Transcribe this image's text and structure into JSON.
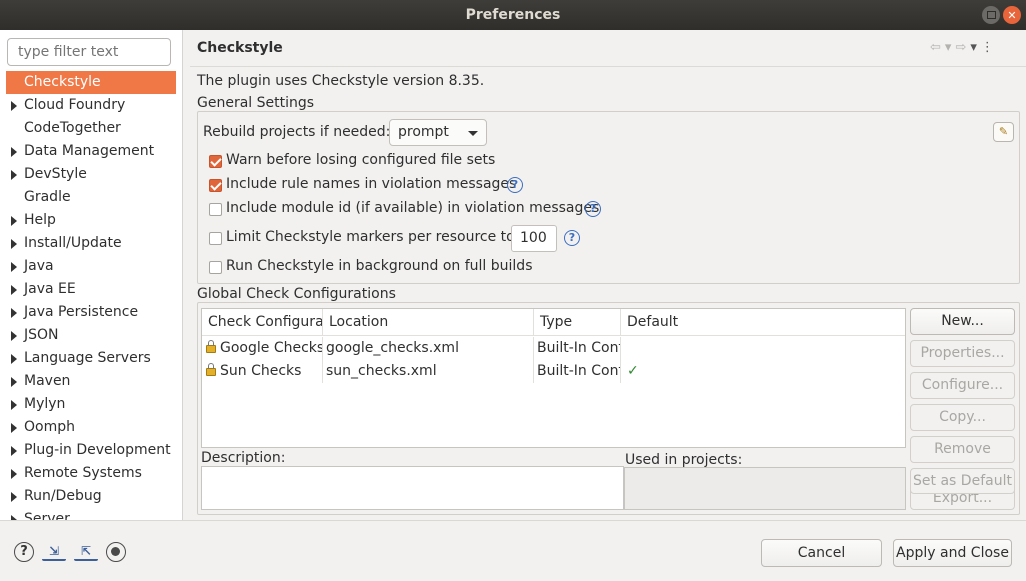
{
  "window": {
    "title": "Preferences"
  },
  "sidebar": {
    "filter_placeholder": "type filter text",
    "items": [
      {
        "label": "Checkstyle",
        "expandable": false,
        "selected": true
      },
      {
        "label": "Cloud Foundry",
        "expandable": true
      },
      {
        "label": "CodeTogether",
        "expandable": false
      },
      {
        "label": "Data Management",
        "expandable": true
      },
      {
        "label": "DevStyle",
        "expandable": true
      },
      {
        "label": "Gradle",
        "expandable": false
      },
      {
        "label": "Help",
        "expandable": true
      },
      {
        "label": "Install/Update",
        "expandable": true
      },
      {
        "label": "Java",
        "expandable": true
      },
      {
        "label": "Java EE",
        "expandable": true
      },
      {
        "label": "Java Persistence",
        "expandable": true
      },
      {
        "label": "JSON",
        "expandable": true
      },
      {
        "label": "Language Servers",
        "expandable": true
      },
      {
        "label": "Maven",
        "expandable": true
      },
      {
        "label": "Mylyn",
        "expandable": true
      },
      {
        "label": "Oomph",
        "expandable": true
      },
      {
        "label": "Plug-in Development",
        "expandable": true
      },
      {
        "label": "Remote Systems",
        "expandable": true
      },
      {
        "label": "Run/Debug",
        "expandable": true
      },
      {
        "label": "Server",
        "expandable": true
      }
    ]
  },
  "page": {
    "title": "Checkstyle",
    "version_text": "The plugin uses Checkstyle version 8.35.",
    "general": {
      "label": "General Settings",
      "rebuild_label": "Rebuild projects if needed:",
      "rebuild_value": "prompt",
      "options": [
        {
          "label": "Warn before losing configured file sets",
          "checked": true,
          "help": false
        },
        {
          "label": "Include rule names in violation messages",
          "checked": true,
          "help": true
        },
        {
          "label": "Include module id (if available) in violation messages",
          "checked": false,
          "help": true
        },
        {
          "label": "Limit Checkstyle markers per resource to",
          "checked": false,
          "help": true
        },
        {
          "label": "Run Checkstyle in background on full builds",
          "checked": false,
          "help": false
        }
      ],
      "marker_limit": "100"
    },
    "global": {
      "label": "Global Check Configurations",
      "columns": [
        "Check Configuration",
        "Location",
        "Type",
        "Default"
      ],
      "rows": [
        {
          "name": "Google Checks",
          "location": "google_checks.xml",
          "type": "Built-In Configuration",
          "default": ""
        },
        {
          "name": "Sun Checks",
          "location": "sun_checks.xml",
          "type": "Built-In Configuration",
          "default": "✓"
        }
      ],
      "buttons": {
        "new": "New...",
        "properties": "Properties...",
        "configure": "Configure...",
        "copy": "Copy...",
        "remove": "Remove",
        "set_default": "Set as Default",
        "export": "Export..."
      },
      "description_label": "Description:",
      "used_in_label": "Used in projects:"
    }
  },
  "footer": {
    "cancel": "Cancel",
    "apply_close": "Apply and Close"
  },
  "colors": {
    "accent": "#f07746",
    "checkbox": "#e0663b",
    "titlebar": "#3b3935"
  }
}
